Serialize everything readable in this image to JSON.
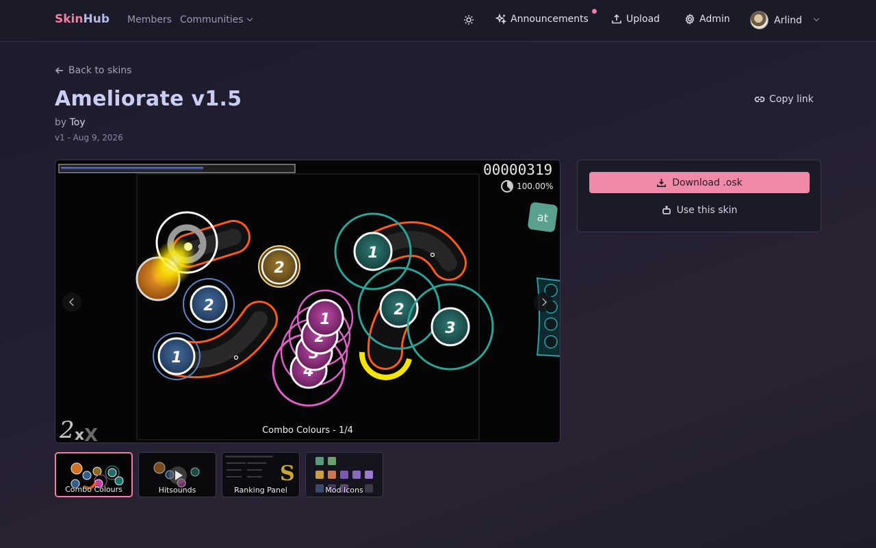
{
  "nav": {
    "logo_part1": "Skin",
    "logo_part2": "Hub",
    "members": "Members",
    "communities": "Communities",
    "announcements": "Announcements",
    "upload": "Upload",
    "admin": "Admin",
    "user_name": "Arlind"
  },
  "header": {
    "back_label": "Back to skins",
    "title": "Ameliorate v1.5",
    "by_prefix": "by",
    "author": "Toy",
    "version_date": "v1 - Aug 9, 2026",
    "copy_link": "Copy link"
  },
  "preview": {
    "score": "00000319",
    "accuracy": "100.00%",
    "mod_badge": "at",
    "caption": "Combo Colours - 1/4",
    "progress": 0.6
  },
  "panel": {
    "download_label": "Download .osk",
    "use_label": "Use this skin"
  },
  "thumbnails": [
    {
      "label": "Combo Colours"
    },
    {
      "label": "Hitsounds"
    },
    {
      "label": "Ranking Panel"
    },
    {
      "label": "Mod Icons"
    }
  ],
  "colors": {
    "accent_pink": "#f07fa3",
    "logo_blue": "#b5b9ea",
    "combo_blue": "#2f5e8f",
    "combo_pink": "#c33fae",
    "combo_teal": "#1f6f6a",
    "combo_gold": "#8a6a20"
  }
}
